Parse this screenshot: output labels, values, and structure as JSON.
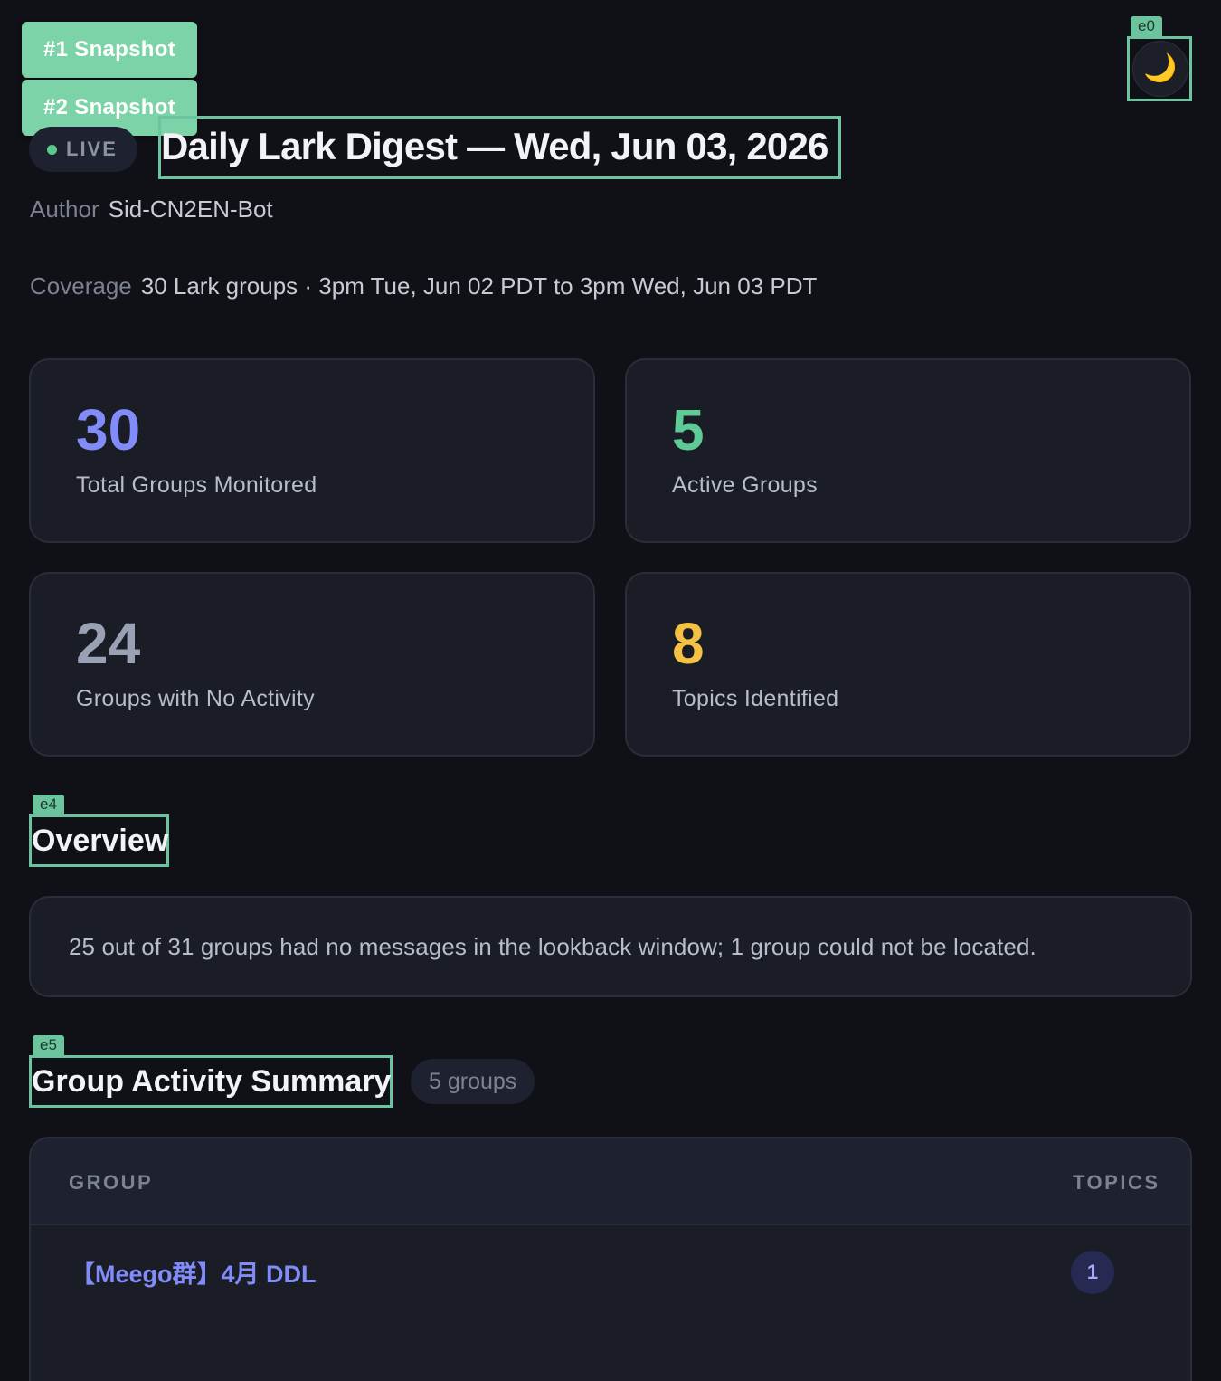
{
  "annotations": {
    "theme_tag": "e0",
    "overview_tag": "e4",
    "activity_tag": "e5"
  },
  "snapshots": [
    {
      "label": "#1 Snapshot"
    },
    {
      "label": "#2 Snapshot"
    }
  ],
  "theme_toggle": {
    "icon": "moon-icon",
    "glyph": "🌙"
  },
  "header": {
    "live_label": "LIVE",
    "title": "Daily Lark Digest — Wed, Jun 03, 2026"
  },
  "meta": {
    "author_key": "Author",
    "author_value": "Sid-CN2EN-Bot",
    "coverage_key": "Coverage",
    "coverage_value": "30 Lark groups · 3pm Tue, Jun 02 PDT to 3pm Wed, Jun 03 PDT"
  },
  "stats": [
    {
      "value": "30",
      "label": "Total Groups Monitored",
      "color": "#818cf8"
    },
    {
      "value": "5",
      "label": "Active Groups",
      "color": "#5ecb96"
    },
    {
      "value": "24",
      "label": "Groups with No Activity",
      "color": "#9aa1b4"
    },
    {
      "value": "8",
      "label": "Topics Identified",
      "color": "#f5c144"
    }
  ],
  "overview": {
    "heading": "Overview",
    "text": "25 out of 31 groups had no messages in the lookback window; 1 group could not be located."
  },
  "activity": {
    "heading": "Group Activity Summary",
    "count_label": "5 groups",
    "columns": {
      "group": "GROUP",
      "topics": "TOPICS"
    },
    "rows": [
      {
        "group": "【Meego群】4月 DDL",
        "topics": "1"
      }
    ]
  },
  "colors": {
    "background": "#101117",
    "card": "#1a1c26",
    "accent_annotation": "#6cc49f",
    "link": "#818cf8"
  }
}
